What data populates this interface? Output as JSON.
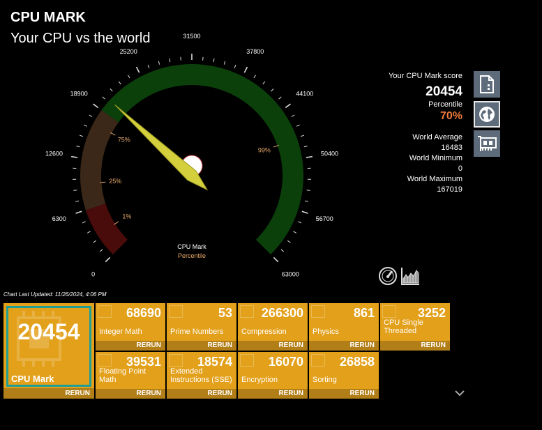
{
  "header": {
    "title": "CPU MARK",
    "subtitle": "Your CPU vs the world"
  },
  "gauge": {
    "min": 0,
    "max": 63000,
    "value": 20454,
    "ticks": [
      "0",
      "6300",
      "12600",
      "18900",
      "25200",
      "31500",
      "37800",
      "44100",
      "50400",
      "56700",
      "63000"
    ],
    "percentile_markers": [
      {
        "label": "1%",
        "value": 3000
      },
      {
        "label": "25%",
        "value": 9500
      },
      {
        "label": "75%",
        "value": 17000
      },
      {
        "label": "99%",
        "value": 48000
      }
    ],
    "bands": [
      {
        "to": 6300,
        "color": "#4a0b0b"
      },
      {
        "to": 18900,
        "color": "#3b2818"
      },
      {
        "to": 63000,
        "color": "#0b400b"
      }
    ],
    "center_label": "CPU Mark",
    "center_sublabel": "Percentile",
    "label_color": "#e8a86a"
  },
  "summary": {
    "score_label": "Your CPU Mark score",
    "score": "20454",
    "percentile_label": "Percentile",
    "percentile": "70%",
    "avg_label": "World Average",
    "avg": "16483",
    "min_label": "World Minimum",
    "min": "0",
    "max_label": "World Maximum",
    "max": "167019"
  },
  "icons": [
    "report-icon",
    "globe-icon",
    "hardware-card-icon",
    "speedometer-icon",
    "area-chart-icon",
    "chevron-down-icon"
  ],
  "chart_updated": "Chart Last Updated: 11/26/2024, 4:06 PM",
  "main_tile": {
    "value": "20454",
    "label": "CPU Mark",
    "rerun": "RERUN"
  },
  "tiles": [
    {
      "value": "68690",
      "label": "Integer Math",
      "rerun": "RERUN"
    },
    {
      "value": "53",
      "label": "Prime Numbers",
      "rerun": "RERUN"
    },
    {
      "value": "266300",
      "label": "Compression",
      "rerun": "RERUN"
    },
    {
      "value": "861",
      "label": "Physics",
      "rerun": "RERUN"
    },
    {
      "value": "3252",
      "label": "CPU Single Threaded",
      "rerun": "RERUN"
    },
    {
      "value": "39531",
      "label": "Floating Point Math",
      "rerun": "RERUN"
    },
    {
      "value": "18574",
      "label": "Extended Instructions (SSE)",
      "rerun": "RERUN"
    },
    {
      "value": "16070",
      "label": "Encryption",
      "rerun": "RERUN"
    },
    {
      "value": "26858",
      "label": "Sorting",
      "rerun": "RERUN"
    }
  ]
}
